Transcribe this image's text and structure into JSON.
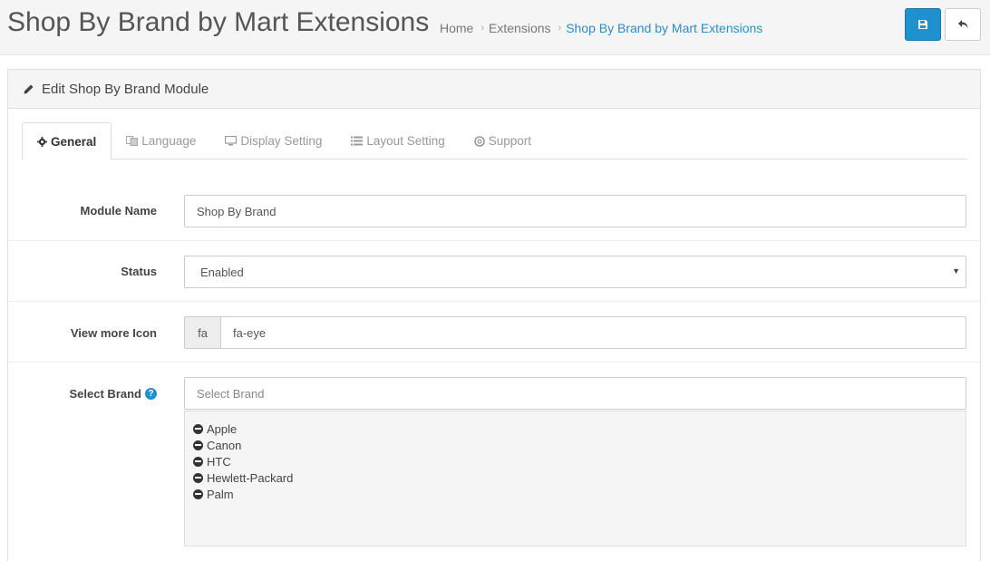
{
  "header": {
    "title": "Shop By Brand by Mart Extensions",
    "breadcrumb": [
      "Home",
      "Extensions",
      "Shop By Brand by Mart Extensions"
    ],
    "breadcrumb_separator": "›",
    "save_icon": "floppy-disk-icon",
    "back_icon": "reply-icon"
  },
  "panel": {
    "heading": "Edit Shop By Brand Module",
    "heading_icon": "pencil-icon"
  },
  "tabs": [
    {
      "label": "General",
      "icon": "gear-icon",
      "active": true
    },
    {
      "label": "Language",
      "icon": "language-icon",
      "active": false
    },
    {
      "label": "Display Setting",
      "icon": "monitor-icon",
      "active": false
    },
    {
      "label": "Layout Setting",
      "icon": "list-icon",
      "active": false
    },
    {
      "label": "Support",
      "icon": "life-ring-icon",
      "active": false
    }
  ],
  "form": {
    "module_name": {
      "label": "Module Name",
      "value": "Shop By Brand"
    },
    "status": {
      "label": "Status",
      "value": "Enabled"
    },
    "view_more_icon": {
      "label": "View more Icon",
      "addon": "fa",
      "value": "fa-eye"
    },
    "select_brand": {
      "label": "Select Brand",
      "placeholder": "Select Brand",
      "help_icon": "question-circle-icon"
    }
  },
  "brands": [
    "Apple",
    "Canon",
    "HTC",
    "Hewlett-Packard",
    "Palm"
  ],
  "colors": {
    "primary": "#1e91cf",
    "link": "#2a8ec7"
  }
}
